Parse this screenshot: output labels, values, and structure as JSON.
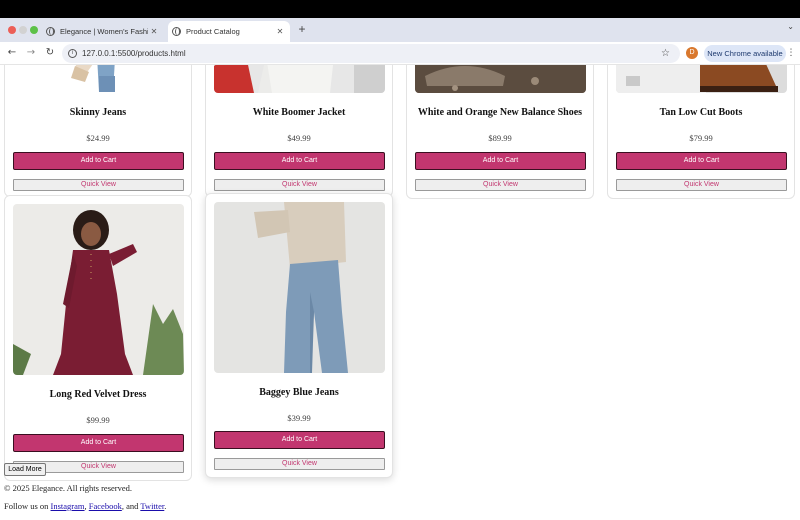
{
  "browser": {
    "tabs": [
      {
        "title": "Elegance | Women's Fashion",
        "active": false
      },
      {
        "title": "Product Catalog",
        "active": true
      }
    ],
    "new_tab_label": "+",
    "url": "127.0.0.1:5500/products.html",
    "profile_initial": "D",
    "update_label": "New Chrome available"
  },
  "products": [
    {
      "name": "Skinny Jeans",
      "price": "$24.99",
      "add_label": "Add to Cart",
      "quick_view_label": "Quick View"
    },
    {
      "name": "White Boomer Jacket",
      "price": "$49.99",
      "add_label": "Add to Cart",
      "quick_view_label": "Quick View"
    },
    {
      "name": "White and Orange New Balance Shoes",
      "price": "$89.99",
      "add_label": "Add to Cart",
      "quick_view_label": "Quick View"
    },
    {
      "name": "Tan Low Cut Boots",
      "price": "$79.99",
      "add_label": "Add to Cart",
      "quick_view_label": "Quick View"
    },
    {
      "name": "Long Red Velvet Dress",
      "price": "$99.99",
      "add_label": "Add to Cart",
      "quick_view_label": "Quick View"
    },
    {
      "name": "Baggey Blue Jeans",
      "price": "$39.99",
      "add_label": "Add to Cart",
      "quick_view_label": "Quick View"
    }
  ],
  "load_more_label": "Load More",
  "footer": {
    "copyright": "© 2025 Elegance. All rights reserved.",
    "follow_prefix": "Follow us on ",
    "links": [
      "Instagram",
      "Facebook",
      "Twitter"
    ],
    "sep1": ", ",
    "sep2": ", and ",
    "end": "."
  },
  "colors": {
    "accent": "#c2366f",
    "tab_strip": "#dfe3ee",
    "update_chip": "#dde6f7"
  }
}
